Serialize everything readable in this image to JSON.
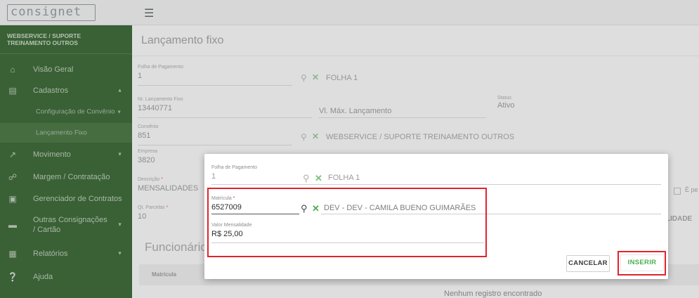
{
  "app": {
    "logo_text": "consignet"
  },
  "sidebar": {
    "header": "WEBSERVICE / SUPORTE TREINAMENTO OUTROS",
    "items": [
      {
        "label": "Visão Geral",
        "icon": "home-icon"
      },
      {
        "label": "Cadastros",
        "icon": "document-icon",
        "expanded": true
      },
      {
        "label": "Configuração de Convênio",
        "sub": true
      },
      {
        "label": "Lançamento Fixo",
        "sub": true,
        "active": true
      },
      {
        "label": "Movimento",
        "icon": "trend-icon"
      },
      {
        "label": "Margem / Contratação",
        "icon": "handshake-icon"
      },
      {
        "label": "Gerenciador de Contratos",
        "icon": "contract-icon"
      },
      {
        "label": "Outras Consignações / Cartão",
        "icon": "card-icon"
      },
      {
        "label": "Relatórios",
        "icon": "chart-icon"
      },
      {
        "label": "Ajuda",
        "icon": "help-icon"
      }
    ]
  },
  "main": {
    "title": "Lançamento fixo",
    "folha": {
      "label": "Folha de Pagamento",
      "value": "1",
      "desc": "FOLHA 1"
    },
    "numero": {
      "label": "Nr. Lançamento Fixo",
      "value": "13440771"
    },
    "vl_max": {
      "placeholder": "Vl. Máx. Lançamento"
    },
    "status": {
      "label": "Status",
      "value": "Ativo"
    },
    "convenio": {
      "label": "Convênio",
      "value": "851",
      "desc": "WEBSERVICE / SUPORTE TREINAMENTO OUTROS"
    },
    "empresa": {
      "label": "Empresa",
      "value": "3820"
    },
    "descricao": {
      "label": "Descrição",
      "value": "MENSALIDADES"
    },
    "parcelas": {
      "label": "Qt. Parcelas",
      "value": "10"
    },
    "checkbox_fragment": "É pe",
    "right_fragment": "LIDADE",
    "section_title": "Funcionário",
    "table": {
      "column_1": "Matrícula",
      "empty_text": "Nenhum registro encontrado"
    }
  },
  "modal": {
    "folha": {
      "label": "Folha de Pagamento",
      "value": "1",
      "desc": "FOLHA 1"
    },
    "matricula": {
      "label": "Matrícula",
      "required_mark": "*",
      "value": "6527009",
      "desc": "DEV - DEV - CAMILA BUENO GUIMARÃES"
    },
    "valor": {
      "label": "Valor Mensalidade",
      "value": "R$ 25,00"
    },
    "cancel_label": "CANCELAR",
    "insert_label": "INSERIR"
  },
  "colors": {
    "sidebar": "#3e6a3a",
    "accent_green": "#4caf50",
    "highlight_red": "#e0242c"
  }
}
